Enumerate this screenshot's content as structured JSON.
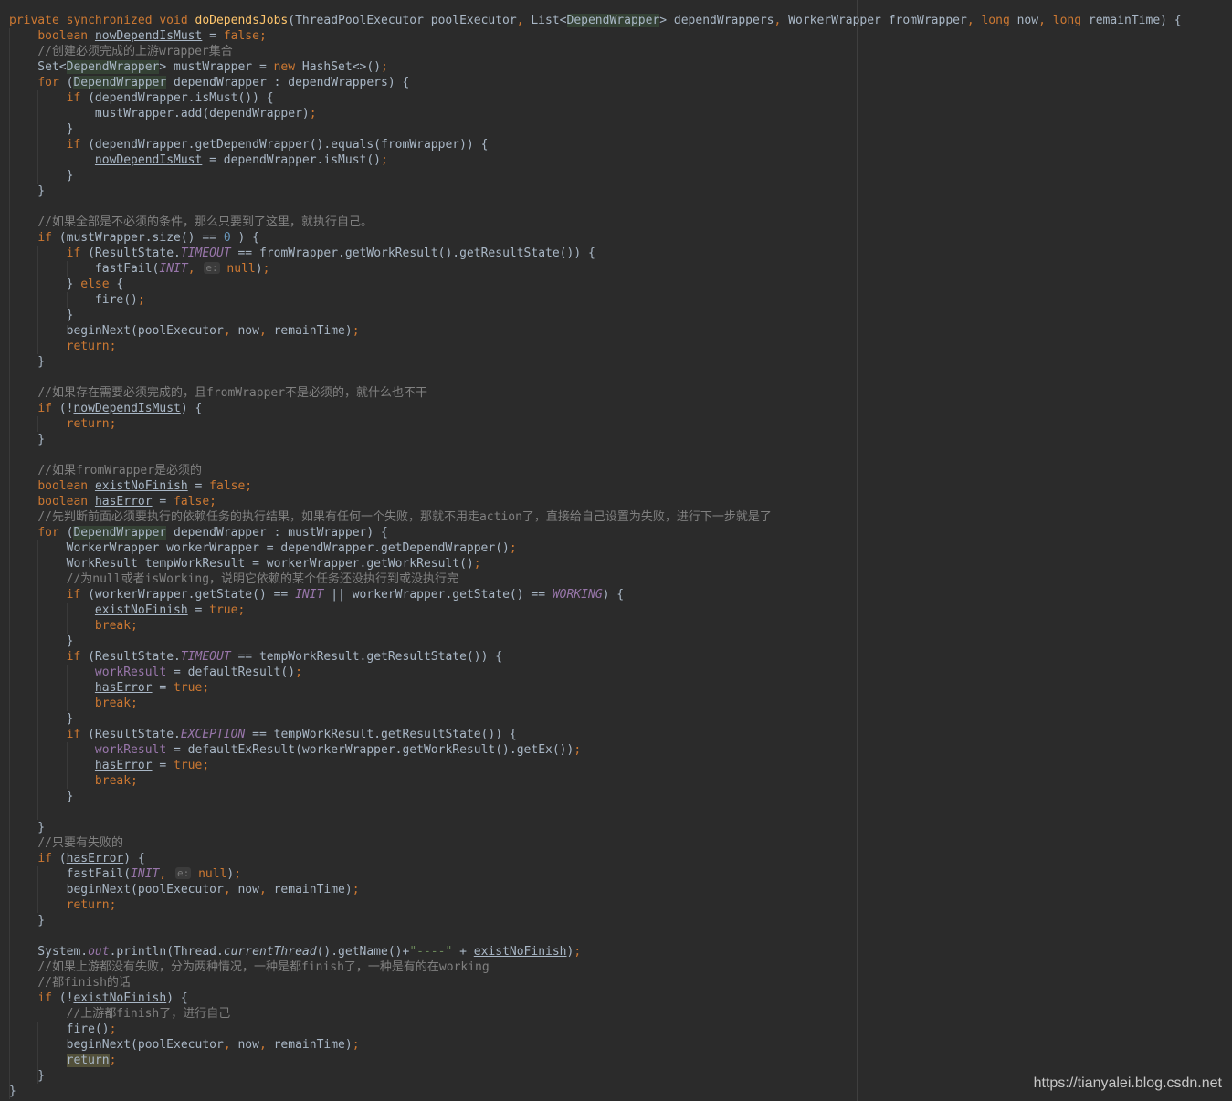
{
  "watermark": "https://tianyalei.blog.csdn.net",
  "code_lines": [
    [
      [
        "kw",
        "private synchronized void "
      ],
      [
        "fn",
        "doDependsJobs"
      ],
      [
        "",
        "(ThreadPoolExecutor poolExecutor"
      ],
      [
        "kw",
        ", "
      ],
      [
        "",
        "List<"
      ],
      [
        "hl",
        "DependWrapper"
      ],
      [
        "",
        "> dependWrappers"
      ],
      [
        "kw",
        ", "
      ],
      [
        "",
        "WorkerWrapper fromWrapper"
      ],
      [
        "kw",
        ", long "
      ],
      [
        "",
        "now"
      ],
      [
        "kw",
        ", long "
      ],
      [
        "",
        "remainTime) {"
      ]
    ],
    [
      [
        "",
        "    "
      ],
      [
        "kw",
        "boolean "
      ],
      [
        "uvar",
        "nowDependIsMust"
      ],
      [
        "",
        " = "
      ],
      [
        "kw",
        "false;"
      ]
    ],
    [
      [
        "",
        "    "
      ],
      [
        "cmt",
        "//创建必须完成的上游wrapper集合"
      ]
    ],
    [
      [
        "",
        "    Set<"
      ],
      [
        "hl",
        "DependWrapper"
      ],
      [
        "",
        "> mustWrapper = "
      ],
      [
        "kw",
        "new "
      ],
      [
        "",
        "HashSet<>()"
      ],
      [
        "kw",
        ";"
      ]
    ],
    [
      [
        "",
        "    "
      ],
      [
        "kw",
        "for "
      ],
      [
        "",
        "("
      ],
      [
        "hl",
        "DependWrapper"
      ],
      [
        "",
        " dependWrapper : dependWrappers) {"
      ]
    ],
    [
      [
        "",
        "        "
      ],
      [
        "kw",
        "if "
      ],
      [
        "",
        "(dependWrapper.isMust()) {"
      ]
    ],
    [
      [
        "",
        "            mustWrapper.add(dependWrapper)"
      ],
      [
        "kw",
        ";"
      ]
    ],
    [
      [
        "",
        "        }"
      ]
    ],
    [
      [
        "",
        "        "
      ],
      [
        "kw",
        "if "
      ],
      [
        "",
        "(dependWrapper.getDependWrapper().equals(fromWrapper)) {"
      ]
    ],
    [
      [
        "",
        "            "
      ],
      [
        "uvar",
        "nowDependIsMust"
      ],
      [
        "",
        " = dependWrapper.isMust()"
      ],
      [
        "kw",
        ";"
      ]
    ],
    [
      [
        "",
        "        }"
      ]
    ],
    [
      [
        "",
        "    }"
      ]
    ],
    [
      [
        "",
        ""
      ]
    ],
    [
      [
        "",
        "    "
      ],
      [
        "cmt",
        "//如果全部是不必须的条件，那么只要到了这里，就执行自己。"
      ]
    ],
    [
      [
        "",
        "    "
      ],
      [
        "kw",
        "if "
      ],
      [
        "",
        "(mustWrapper.size() == "
      ],
      [
        "num",
        "0"
      ],
      [
        "",
        " ) {"
      ]
    ],
    [
      [
        "",
        "        "
      ],
      [
        "kw",
        "if "
      ],
      [
        "",
        "(ResultState."
      ],
      [
        "cst",
        "TIMEOUT"
      ],
      [
        "",
        " == fromWrapper.getWorkResult().getResultState()) {"
      ]
    ],
    [
      [
        "",
        "            fastFail("
      ],
      [
        "cst",
        "INIT"
      ],
      [
        "kw",
        ", "
      ],
      [
        "hint",
        "e:"
      ],
      [
        "",
        " "
      ],
      [
        "kw",
        "null"
      ],
      [
        "",
        ")"
      ],
      [
        "kw",
        ";"
      ]
    ],
    [
      [
        "",
        "        } "
      ],
      [
        "kw",
        "else "
      ],
      [
        "",
        "{"
      ]
    ],
    [
      [
        "",
        "            fire()"
      ],
      [
        "kw",
        ";"
      ]
    ],
    [
      [
        "",
        "        }"
      ]
    ],
    [
      [
        "",
        "        beginNext(poolExecutor"
      ],
      [
        "kw",
        ", "
      ],
      [
        "",
        "now"
      ],
      [
        "kw",
        ", "
      ],
      [
        "",
        "remainTime)"
      ],
      [
        "kw",
        ";"
      ]
    ],
    [
      [
        "",
        "        "
      ],
      [
        "kw",
        "return;"
      ]
    ],
    [
      [
        "",
        "    }"
      ]
    ],
    [
      [
        "",
        ""
      ]
    ],
    [
      [
        "",
        "    "
      ],
      [
        "cmt",
        "//如果存在需要必须完成的，且fromWrapper不是必须的，就什么也不干"
      ]
    ],
    [
      [
        "",
        "    "
      ],
      [
        "kw",
        "if "
      ],
      [
        "",
        "(!"
      ],
      [
        "uvar",
        "nowDependIsMust"
      ],
      [
        "",
        ") {"
      ]
    ],
    [
      [
        "",
        "        "
      ],
      [
        "kw",
        "return;"
      ]
    ],
    [
      [
        "",
        "    }"
      ]
    ],
    [
      [
        "",
        ""
      ]
    ],
    [
      [
        "",
        "    "
      ],
      [
        "cmt",
        "//如果fromWrapper是必须的"
      ]
    ],
    [
      [
        "",
        "    "
      ],
      [
        "kw",
        "boolean "
      ],
      [
        "uvar",
        "existNoFinish"
      ],
      [
        "",
        " = "
      ],
      [
        "kw",
        "false;"
      ]
    ],
    [
      [
        "",
        "    "
      ],
      [
        "kw",
        "boolean "
      ],
      [
        "uvar",
        "hasError"
      ],
      [
        "",
        " = "
      ],
      [
        "kw",
        "false;"
      ]
    ],
    [
      [
        "",
        "    "
      ],
      [
        "cmt",
        "//先判断前面必须要执行的依赖任务的执行结果，如果有任何一个失败，那就不用走action了，直接给自己设置为失败，进行下一步就是了"
      ]
    ],
    [
      [
        "",
        "    "
      ],
      [
        "kw",
        "for "
      ],
      [
        "",
        "("
      ],
      [
        "hl",
        "DependWrapper"
      ],
      [
        "",
        " dependWrapper : mustWrapper) {"
      ]
    ],
    [
      [
        "",
        "        WorkerWrapper workerWrapper = dependWrapper.getDependWrapper()"
      ],
      [
        "kw",
        ";"
      ]
    ],
    [
      [
        "",
        "        WorkResult tempWorkResult = workerWrapper.getWorkResult()"
      ],
      [
        "kw",
        ";"
      ]
    ],
    [
      [
        "",
        "        "
      ],
      [
        "cmt",
        "//为null或者isWorking，说明它依赖的某个任务还没执行到或没执行完"
      ]
    ],
    [
      [
        "",
        "        "
      ],
      [
        "kw",
        "if "
      ],
      [
        "",
        "(workerWrapper.getState() == "
      ],
      [
        "cst",
        "INIT"
      ],
      [
        "",
        " || workerWrapper.getState() == "
      ],
      [
        "cst",
        "WORKING"
      ],
      [
        "",
        ") {"
      ]
    ],
    [
      [
        "",
        "            "
      ],
      [
        "uvar",
        "existNoFinish"
      ],
      [
        "",
        " = "
      ],
      [
        "kw",
        "true;"
      ]
    ],
    [
      [
        "",
        "            "
      ],
      [
        "kw",
        "break;"
      ]
    ],
    [
      [
        "",
        "        }"
      ]
    ],
    [
      [
        "",
        "        "
      ],
      [
        "kw",
        "if "
      ],
      [
        "",
        "(ResultState."
      ],
      [
        "cst",
        "TIMEOUT"
      ],
      [
        "",
        " == tempWorkResult.getResultState()) {"
      ]
    ],
    [
      [
        "",
        "            "
      ],
      [
        "fld",
        "workResult"
      ],
      [
        "",
        " = defaultResult()"
      ],
      [
        "kw",
        ";"
      ]
    ],
    [
      [
        "",
        "            "
      ],
      [
        "uvar",
        "hasError"
      ],
      [
        "",
        " = "
      ],
      [
        "kw",
        "true;"
      ]
    ],
    [
      [
        "",
        "            "
      ],
      [
        "kw",
        "break;"
      ]
    ],
    [
      [
        "",
        "        }"
      ]
    ],
    [
      [
        "",
        "        "
      ],
      [
        "kw",
        "if "
      ],
      [
        "",
        "(ResultState."
      ],
      [
        "cst",
        "EXCEPTION"
      ],
      [
        "",
        " == tempWorkResult.getResultState()) {"
      ]
    ],
    [
      [
        "",
        "            "
      ],
      [
        "fld",
        "workResult"
      ],
      [
        "",
        " = defaultExResult(workerWrapper.getWorkResult().getEx())"
      ],
      [
        "kw",
        ";"
      ]
    ],
    [
      [
        "",
        "            "
      ],
      [
        "uvar",
        "hasError"
      ],
      [
        "",
        " = "
      ],
      [
        "kw",
        "true;"
      ]
    ],
    [
      [
        "",
        "            "
      ],
      [
        "kw",
        "break;"
      ]
    ],
    [
      [
        "",
        "        }"
      ]
    ],
    [
      [
        "",
        ""
      ]
    ],
    [
      [
        "",
        "    }"
      ]
    ],
    [
      [
        "",
        "    "
      ],
      [
        "cmt",
        "//只要有失败的"
      ]
    ],
    [
      [
        "",
        "    "
      ],
      [
        "kw",
        "if "
      ],
      [
        "",
        "("
      ],
      [
        "uvar",
        "hasError"
      ],
      [
        "",
        ") {"
      ]
    ],
    [
      [
        "",
        "        fastFail("
      ],
      [
        "cst",
        "INIT"
      ],
      [
        "kw",
        ", "
      ],
      [
        "hint",
        "e:"
      ],
      [
        "",
        " "
      ],
      [
        "kw",
        "null"
      ],
      [
        "",
        ")"
      ],
      [
        "kw",
        ";"
      ]
    ],
    [
      [
        "",
        "        beginNext(poolExecutor"
      ],
      [
        "kw",
        ", "
      ],
      [
        "",
        "now"
      ],
      [
        "kw",
        ", "
      ],
      [
        "",
        "remainTime)"
      ],
      [
        "kw",
        ";"
      ]
    ],
    [
      [
        "",
        "        "
      ],
      [
        "kw",
        "return;"
      ]
    ],
    [
      [
        "",
        "    }"
      ]
    ],
    [
      [
        "",
        ""
      ]
    ],
    [
      [
        "",
        "    System."
      ],
      [
        "cst",
        "out"
      ],
      [
        "",
        ".println(Thread."
      ],
      [
        "itl",
        "currentThread"
      ],
      [
        "",
        "().getName()+"
      ],
      [
        "str",
        "\"----\""
      ],
      [
        "",
        " + "
      ],
      [
        "uvar",
        "existNoFinish"
      ],
      [
        "",
        ")"
      ],
      [
        "kw",
        ";"
      ]
    ],
    [
      [
        "",
        "    "
      ],
      [
        "cmt",
        "//如果上游都没有失败，分为两种情况，一种是都finish了，一种是有的在working"
      ]
    ],
    [
      [
        "",
        "    "
      ],
      [
        "cmt",
        "//都finish的话"
      ]
    ],
    [
      [
        "",
        "    "
      ],
      [
        "kw",
        "if "
      ],
      [
        "",
        "(!"
      ],
      [
        "uvar",
        "existNoFinish"
      ],
      [
        "",
        ") {"
      ]
    ],
    [
      [
        "",
        "        "
      ],
      [
        "cmt",
        "//上游都finish了，进行自己"
      ]
    ],
    [
      [
        "",
        "        fire()"
      ],
      [
        "kw",
        ";"
      ]
    ],
    [
      [
        "",
        "        beginNext(poolExecutor"
      ],
      [
        "kw",
        ", "
      ],
      [
        "",
        "now"
      ],
      [
        "kw",
        ", "
      ],
      [
        "",
        "remainTime)"
      ],
      [
        "kw",
        ";"
      ]
    ],
    [
      [
        "",
        "        "
      ],
      [
        "ret-hl",
        "return"
      ],
      [
        "kw",
        ";"
      ]
    ],
    [
      [
        "",
        "    }"
      ]
    ],
    [
      [
        "",
        "}"
      ]
    ]
  ]
}
